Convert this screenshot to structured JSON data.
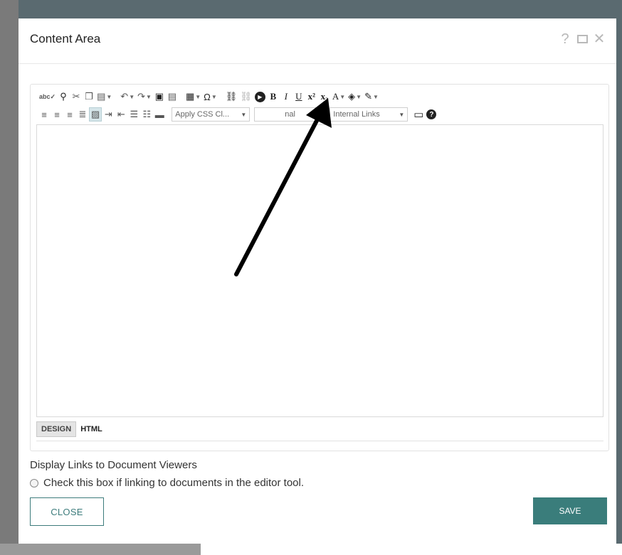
{
  "dialog": {
    "title": "Content Area",
    "help_glyph": "?",
    "close_glyph": "✕"
  },
  "toolbar": {
    "row1": [
      {
        "name": "spellcheck-icon",
        "glyph": "abc✓"
      },
      {
        "name": "find-icon",
        "glyph": "⚲"
      },
      {
        "name": "cut-icon",
        "glyph": "✂"
      },
      {
        "name": "copy-icon",
        "glyph": "❐"
      },
      {
        "name": "paste-icon",
        "glyph": "📋"
      },
      {
        "name": "undo-icon",
        "glyph": "↶"
      },
      {
        "name": "redo-icon",
        "glyph": "↷"
      },
      {
        "name": "image-icon",
        "glyph": "▣"
      },
      {
        "name": "document-icon",
        "glyph": "▤"
      },
      {
        "name": "table-icon",
        "glyph": "▦"
      },
      {
        "name": "special-char-icon",
        "glyph": "Ω"
      },
      {
        "name": "link-icon",
        "glyph": "⛓"
      },
      {
        "name": "unlink-icon",
        "glyph": "⛓"
      },
      {
        "name": "media-play-icon",
        "glyph": "▶"
      },
      {
        "name": "bold-icon",
        "glyph": "B"
      },
      {
        "name": "italic-icon",
        "glyph": "I"
      },
      {
        "name": "underline-icon",
        "glyph": "U"
      },
      {
        "name": "superscript-icon",
        "glyph": "x²"
      },
      {
        "name": "subscript-icon",
        "glyph": "x₂"
      },
      {
        "name": "font-color-icon",
        "glyph": "A"
      },
      {
        "name": "highlight-icon",
        "glyph": "◈"
      },
      {
        "name": "format-brush-icon",
        "glyph": "✎"
      }
    ],
    "row2": [
      {
        "name": "align-left-icon",
        "glyph": "≡"
      },
      {
        "name": "align-center-icon",
        "glyph": "≡"
      },
      {
        "name": "align-right-icon",
        "glyph": "≡"
      },
      {
        "name": "align-justify-icon",
        "glyph": "≣"
      },
      {
        "name": "align-none-icon",
        "glyph": "▨"
      },
      {
        "name": "indent-icon",
        "glyph": "⇥"
      },
      {
        "name": "outdent-icon",
        "glyph": "⇤"
      },
      {
        "name": "numbered-list-icon",
        "glyph": "☰"
      },
      {
        "name": "bulleted-list-icon",
        "glyph": "☷"
      },
      {
        "name": "horizontal-rule-icon",
        "glyph": "▬"
      }
    ],
    "css_class_select": "Apply CSS Cl...",
    "paragraph_select": "nal",
    "links_select": "Internal Links",
    "preview_icon": "▭",
    "help_icon": "?"
  },
  "modes": {
    "design": "DESIGN",
    "html": "HTML"
  },
  "document_viewers": {
    "label": "Display Links to Document Viewers",
    "checkbox_label": "Check this box if linking to documents in the editor tool."
  },
  "buttons": {
    "close": "CLOSE",
    "save": "SAVE"
  },
  "colors": {
    "accent": "#3a7d7b",
    "overlay": "#5a6a70"
  }
}
